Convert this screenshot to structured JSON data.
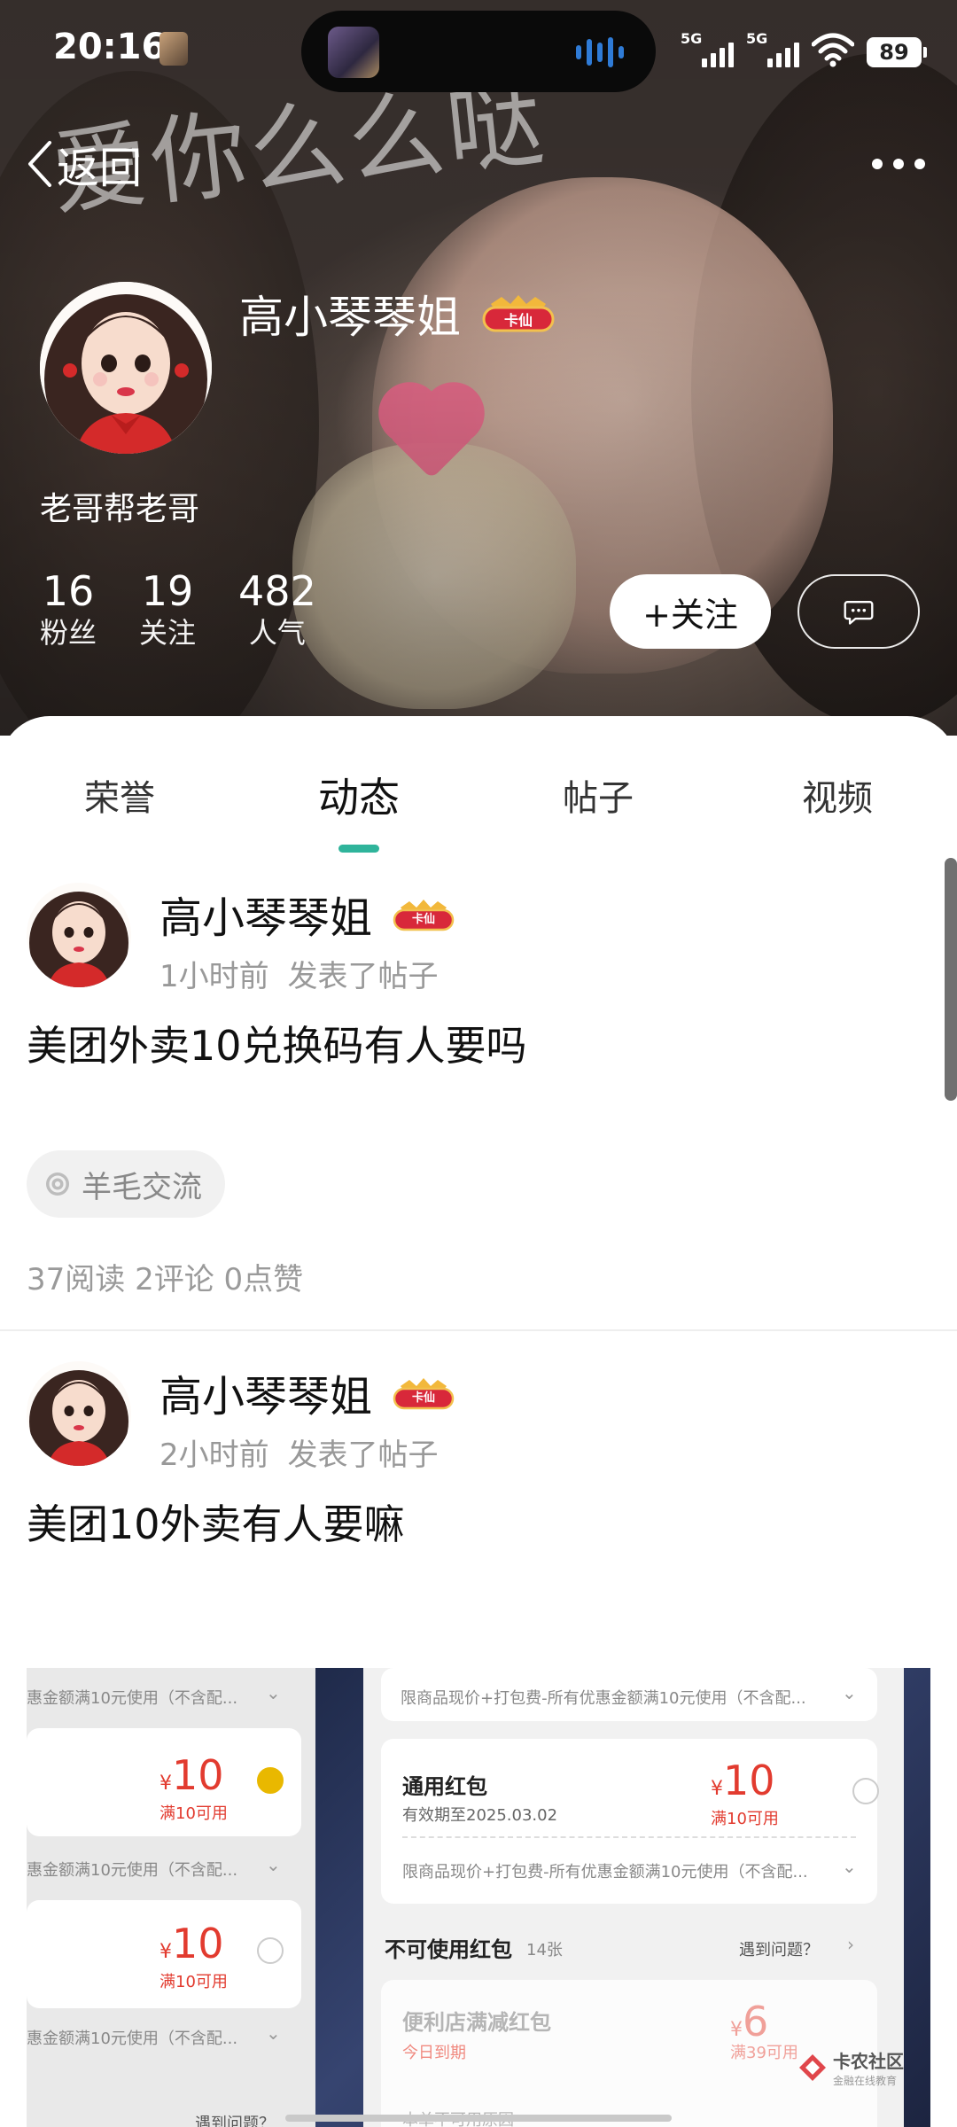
{
  "status_bar": {
    "time": "20:16",
    "net1": "5G",
    "net2": "5G",
    "battery": "89"
  },
  "nav": {
    "back_label": "返回"
  },
  "banner": {
    "watermark_text": "爱你么么哒"
  },
  "profile": {
    "nickname": "高小琴琴姐",
    "badge_text": "卡仙",
    "signature": "老哥帮老哥",
    "stats": [
      {
        "num": "16",
        "label": "粉丝"
      },
      {
        "num": "19",
        "label": "关注"
      },
      {
        "num": "482",
        "label": "人气"
      }
    ],
    "follow_label": "+关注"
  },
  "tabs": [
    "荣誉",
    "动态",
    "帖子",
    "视频"
  ],
  "active_tab": "动态",
  "posts": [
    {
      "author": "高小琴琴姐",
      "time": "1小时前",
      "action": "发表了帖子",
      "text": "美团外卖10兑换码有人要吗",
      "topic": "羊毛交流",
      "counts": "37阅读 2评论 0点赞"
    },
    {
      "author": "高小琴琴姐",
      "time": "2小时前",
      "action": "发表了帖子",
      "text": "美团10外卖有人要嘛"
    }
  ],
  "screenshot": {
    "left_rule": "惠金额满10元使用（不含配...",
    "left_amount": "10",
    "left_cond": "满10可用",
    "currency": "¥",
    "right_rule": "限商品现价+打包费-所有优惠金额满10元使用（不含配...",
    "card_title": "通用红包",
    "card_valid": "有效期至2025.03.02",
    "card_amount": "10",
    "card_cond": "满10可用",
    "unusable_title": "不可使用红包",
    "unusable_count": "14张",
    "help": "遇到问题？",
    "card2_title": "便利店满减红包",
    "card2_tag": "今日到期",
    "card2_amount": "6",
    "card2_cond": "满39可用",
    "card2_reason": "本单不可用原因",
    "left_help": "遇到问题？",
    "logo_text": "卡农社区",
    "logo_sub": "金融在线教育"
  },
  "colors": {
    "accent": "#2fb49b",
    "red": "#e23b2f",
    "muted": "#999999"
  }
}
